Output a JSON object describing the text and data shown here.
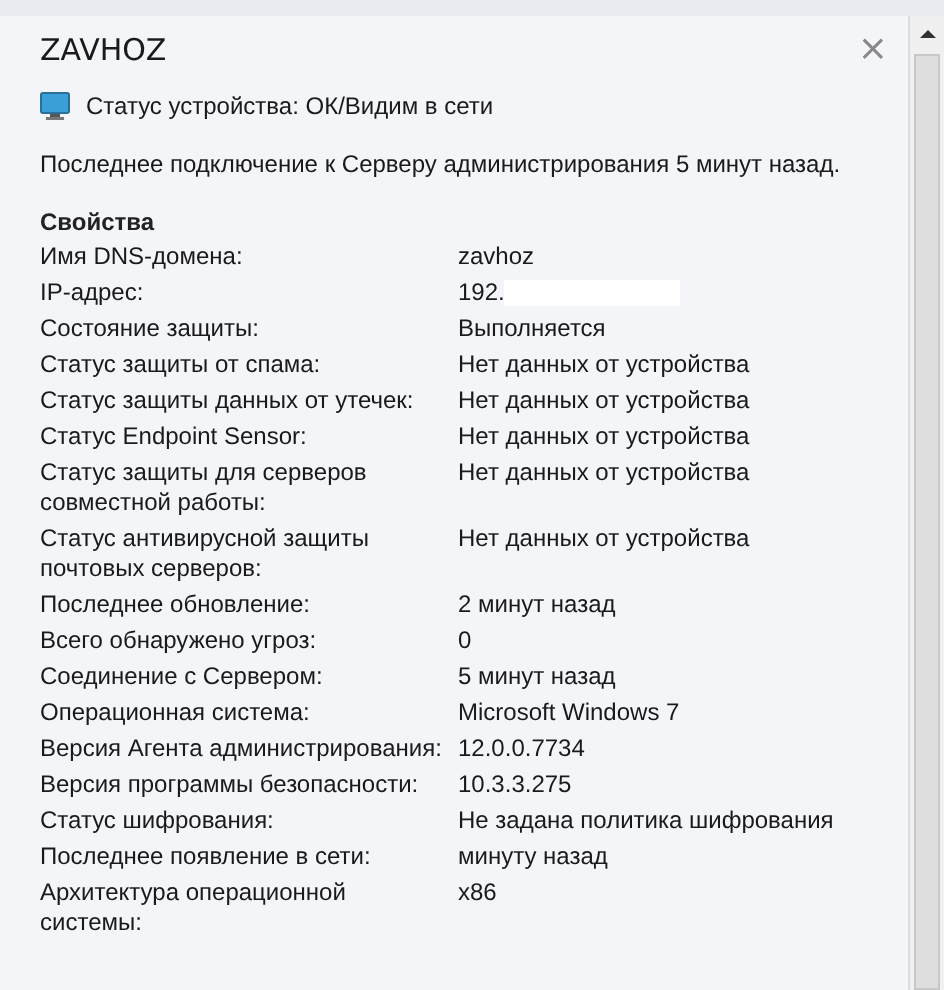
{
  "panel": {
    "title": "ZAVHOZ",
    "close": "×"
  },
  "status": {
    "text": "Статус устройства: ОК/Видим в сети"
  },
  "last_connection": "Последнее подключение к Серверу администрирования 5 минут назад.",
  "properties": {
    "heading": "Свойства",
    "rows": [
      {
        "label": "Имя DNS-домена:",
        "value": "zavhoz"
      },
      {
        "label": "IP-адрес:",
        "value": "192.",
        "redacted": true
      },
      {
        "label": "Состояние защиты:",
        "value": "Выполняется"
      },
      {
        "label": "Статус защиты от спама:",
        "value": "Нет данных от устройства"
      },
      {
        "label": "Статус защиты данных от утечек:",
        "value": "Нет данных от устройства"
      },
      {
        "label": "Статус Endpoint Sensor:",
        "value": "Нет данных от устройства"
      },
      {
        "label": "Статус защиты для серверов совместной работы:",
        "value": "Нет данных от устройства"
      },
      {
        "label": "Статус антивирусной защиты почтовых серверов:",
        "value": "Нет данных от устройства"
      },
      {
        "label": "Последнее обновление:",
        "value": "2 минут назад"
      },
      {
        "label": "Всего обнаружено угроз:",
        "value": "0"
      },
      {
        "label": "Соединение с Сервером:",
        "value": "5 минут назад"
      },
      {
        "label": "Операционная система:",
        "value": "Microsoft Windows 7"
      },
      {
        "label": "Версия Агента администрирования:",
        "value": "12.0.0.7734"
      },
      {
        "label": "Версия программы безопасности:",
        "value": "10.3.3.275"
      },
      {
        "label": "Статус шифрования:",
        "value": "Не задана политика шифрования"
      },
      {
        "label": "Последнее появление в сети:",
        "value": "минуту назад"
      },
      {
        "label": "Архитектура операционной системы:",
        "value": "x86"
      }
    ]
  }
}
